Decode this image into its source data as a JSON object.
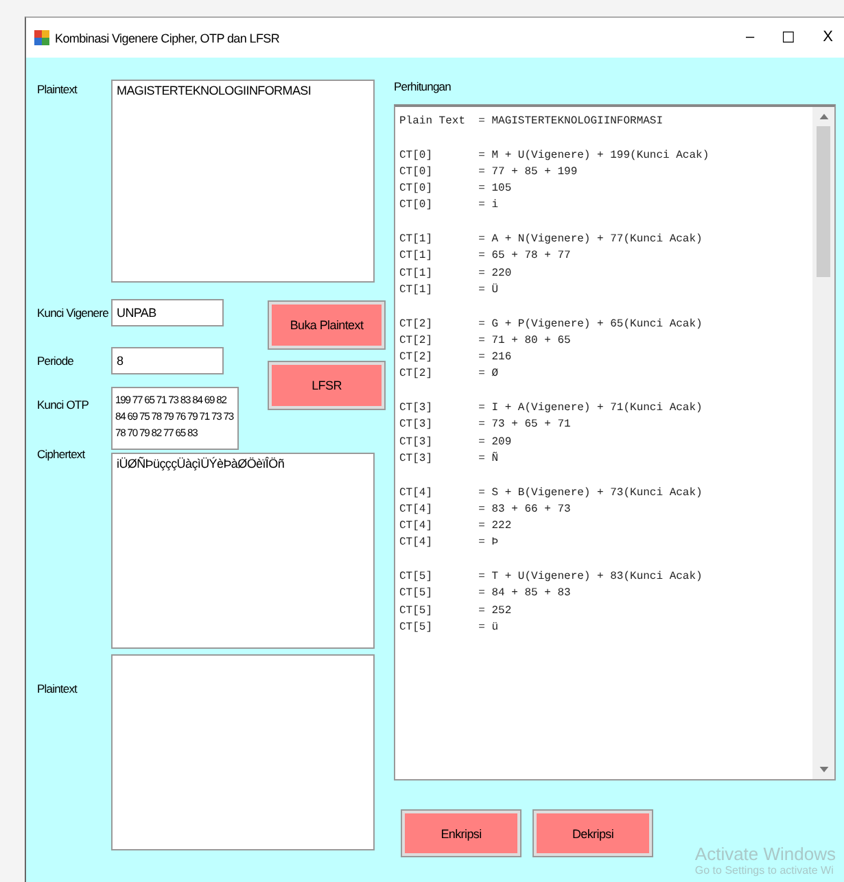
{
  "window": {
    "title": "Kombinasi Vigenere Cipher, OTP dan LFSR",
    "controls": [
      "–",
      "☐",
      "X"
    ]
  },
  "form": {
    "plaintext_label": "Plaintext",
    "plaintext": "MAGISTERTEKNOLOGIINFORMASI",
    "vigenere_label": "Kunci Vigenere",
    "vigenere_key": "UNPAB",
    "period_label": "Periode",
    "period": "8",
    "otp_label": "Kunci OTP",
    "otp_key": "199 77 65 71 73 83 84 69 82 84 69 75 78 79 76 79 71 73 73 78 70 79 82 77 65 83",
    "ciphertext_label": "Ciphertext",
    "ciphertext": "iÜØÑÞüçççÜàçìÜÝèÞàØÖèïÎÖñ",
    "result_label": "Plaintext",
    "buttons": [
      "Buka Plaintext",
      "LFSR"
    ]
  },
  "calculation": {
    "label": "Perhitungan",
    "header": "Plain Text  = MAGISTERTEKNOLOGIINFORMASI",
    "groups": [
      {
        "lines": [
          "CT[0]       = M + U(Vigenere) + 199(Kunci Acak)",
          "CT[0]       = 77 + 85 + 199",
          "CT[0]       = 105",
          "CT[0]       = i"
        ]
      },
      {
        "lines": [
          "CT[1]       = A + N(Vigenere) + 77(Kunci Acak)",
          "CT[1]       = 65 + 78 + 77",
          "CT[1]       = 220",
          "CT[1]       = Ü"
        ]
      },
      {
        "lines": [
          "CT[2]       = G + P(Vigenere) + 65(Kunci Acak)",
          "CT[2]       = 71 + 80 + 65",
          "CT[2]       = 216",
          "CT[2]       = Ø"
        ]
      },
      {
        "lines": [
          "CT[3]       = I + A(Vigenere) + 71(Kunci Acak)",
          "CT[3]       = 73 + 65 + 71",
          "CT[3]       = 209",
          "CT[3]       = Ñ"
        ]
      },
      {
        "lines": [
          "CT[4]       = S + B(Vigenere) + 73(Kunci Acak)",
          "CT[4]       = 83 + 66 + 73",
          "CT[4]       = 222",
          "CT[4]       = Þ"
        ]
      },
      {
        "lines": [
          "CT[5]       = T + U(Vigenere) + 83(Kunci Acak)",
          "CT[5]       = 84 + 85 + 83",
          "CT[5]       = 252",
          "CT[5]       = ü"
        ]
      }
    ]
  },
  "actions": [
    "Enkripsi",
    "Dekripsi"
  ],
  "activation_notice": {
    "title": "Activate Windows",
    "message": "Go to Settings to activate Wi"
  }
}
